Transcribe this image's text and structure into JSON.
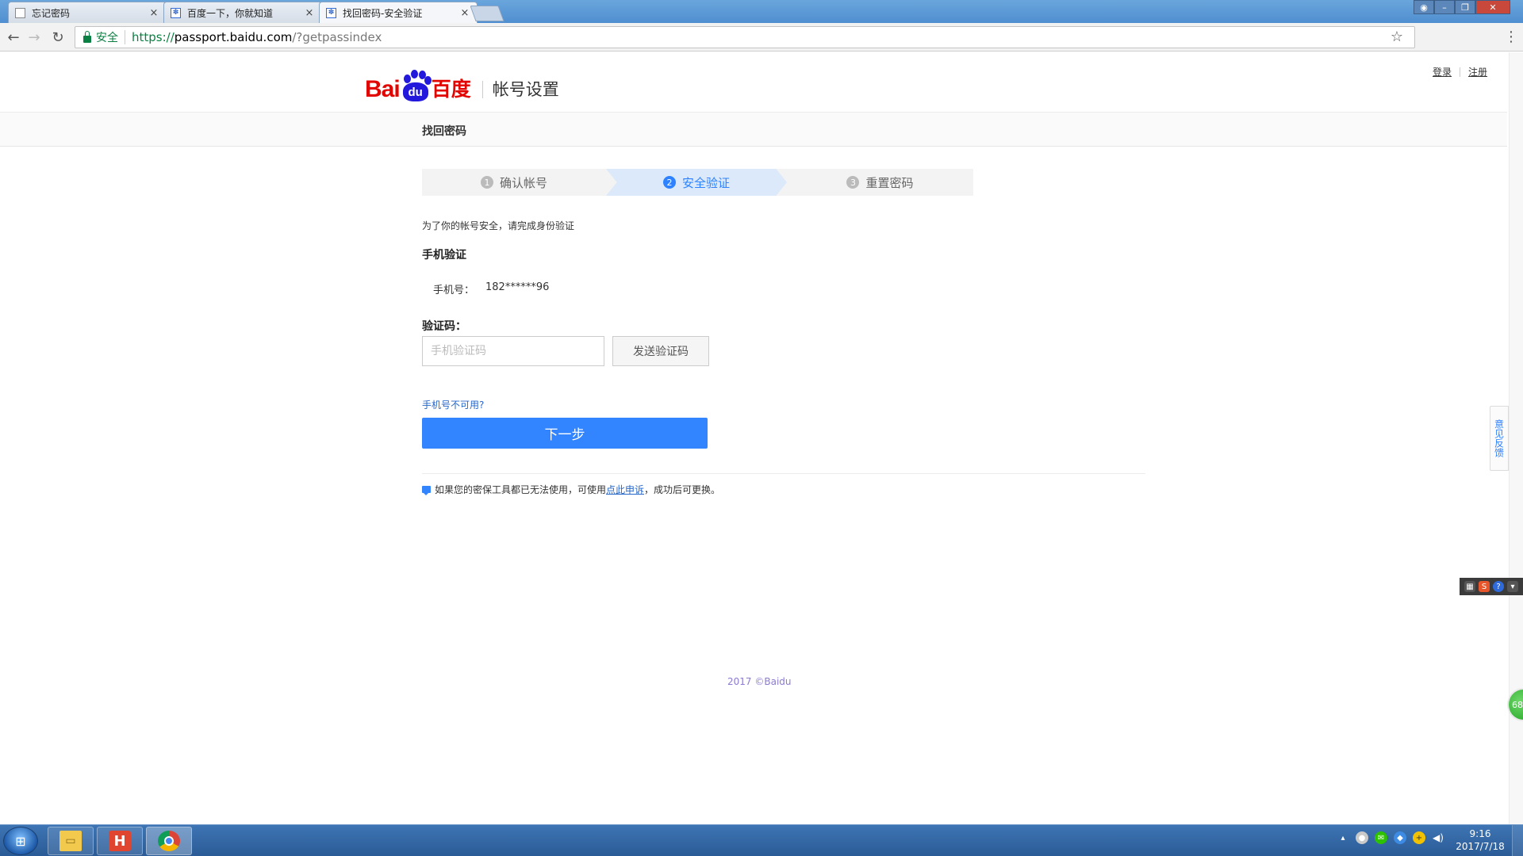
{
  "browser": {
    "tabs": [
      {
        "label": "忘记密码",
        "close": "×"
      },
      {
        "label": "百度一下，你就知道",
        "close": "×"
      },
      {
        "label": "找回密码-安全验证",
        "close": "×"
      }
    ],
    "secure_label": "安全",
    "url_scheme": "https://",
    "url_host": "passport.baidu.com",
    "url_path": "/?getpassindex"
  },
  "header": {
    "logo_latin": "Bai",
    "logo_paw": "du",
    "logo_cn": "百度",
    "section_title": "帐号设置",
    "login_link": "登录",
    "register_link": "注册"
  },
  "subbar": {
    "title": "找回密码"
  },
  "steps": [
    {
      "num": "1",
      "label": "确认帐号",
      "state": "done"
    },
    {
      "num": "2",
      "label": "安全验证",
      "state": "active"
    },
    {
      "num": "3",
      "label": "重置密码",
      "state": "pending"
    }
  ],
  "form": {
    "note": "为了你的帐号安全，请完成身份验证",
    "section_title": "手机验证",
    "phone_label": "手机号：",
    "phone_value": "182******96",
    "code_label": "验证码：",
    "code_placeholder": "手机验证码",
    "code_value": "",
    "send_button": "发送验证码",
    "unavailable_link": "手机号不可用?",
    "next_button": "下一步",
    "hint_prefix": "如果您的密保工具都已无法使用，可使用",
    "hint_link": "点此申诉",
    "hint_suffix": "，成功后可更换。"
  },
  "footer": {
    "copyright": "2017 ©Baidu"
  },
  "side": {
    "feedback": "意见反馈",
    "green_badge": "68"
  },
  "taskbar": {
    "time": "9:16",
    "date": "2017/7/18"
  },
  "colors": {
    "accent": "#3385ff",
    "baidu_red": "#e10601",
    "baidu_blue": "#2319dc",
    "link": "#2666c9"
  }
}
